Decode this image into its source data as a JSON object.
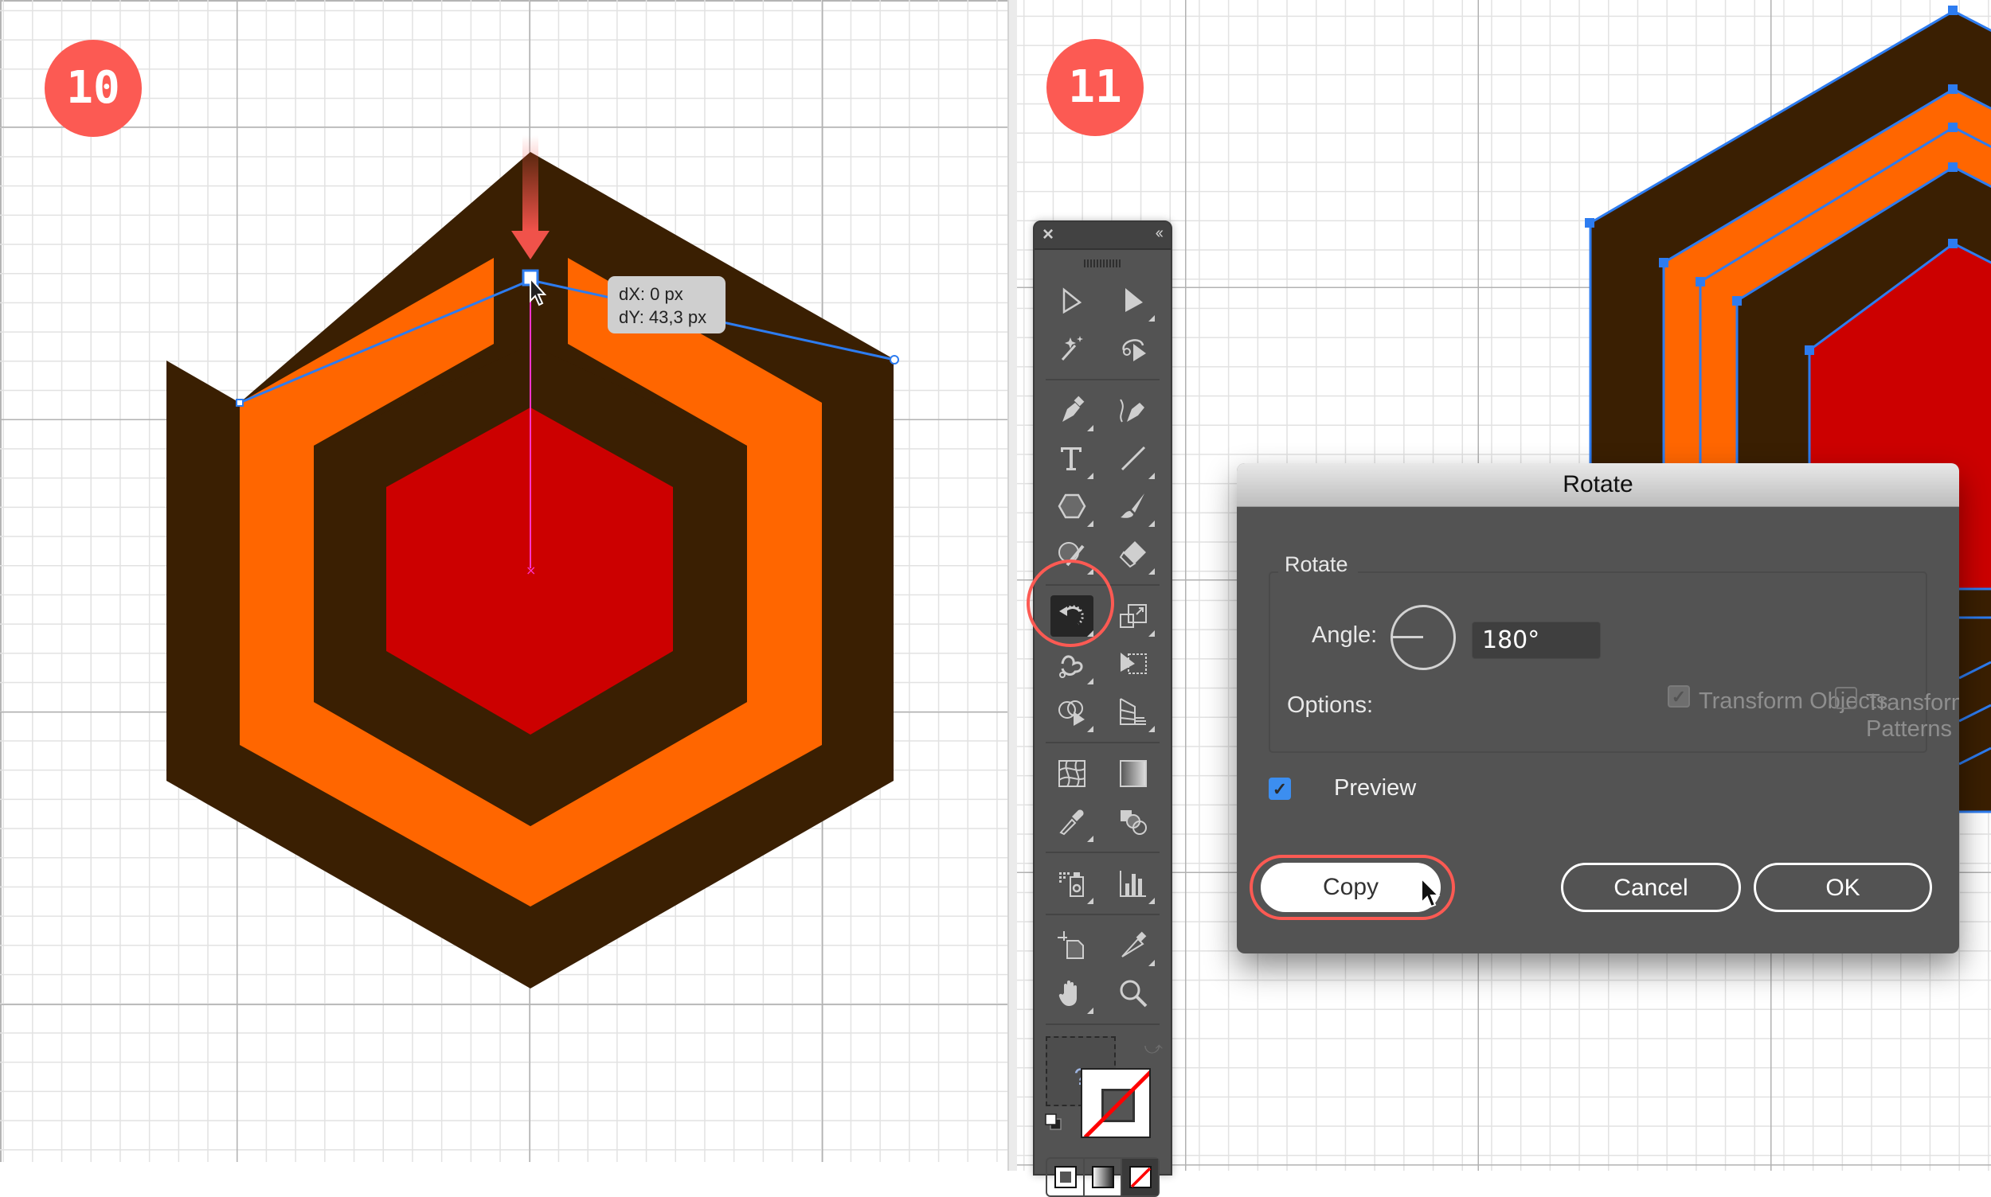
{
  "steps": {
    "left_badge": "10",
    "right_badge": "11"
  },
  "canvas_left": {
    "tooltip": {
      "dx": "dX: 0 px",
      "dy": "dY: 43,3 px"
    },
    "colors": {
      "dark_brown": "#3a1f02",
      "orange": "#ff6600",
      "red": "#cc0000",
      "selection_blue": "#2d7cf0",
      "guide_magenta": "#ff33cc",
      "arrow_red": "#f0524a"
    }
  },
  "toolbar": {
    "close_icon": "×",
    "collapse_icon": "‹‹",
    "tools": [
      [
        "selection-tool",
        "direct-selection-tool"
      ],
      [
        "magic-wand-tool",
        "lasso-tool"
      ],
      [
        "pen-tool",
        "curvature-tool"
      ],
      [
        "type-tool",
        "line-segment-tool"
      ],
      [
        "polygon-tool",
        "paintbrush-tool"
      ],
      [
        "shaper-tool",
        "eraser-tool"
      ],
      [
        "rotate-tool",
        "scale-tool"
      ],
      [
        "puppet-warp-tool",
        "free-transform-tool"
      ],
      [
        "shape-builder-tool",
        "perspective-grid-tool"
      ],
      [
        "mesh-tool",
        "gradient-tool"
      ],
      [
        "eyedropper-tool",
        "blend-tool"
      ],
      [
        "symbol-sprayer-tool",
        "column-graph-tool"
      ],
      [
        "artboard-tool",
        "slice-tool"
      ],
      [
        "hand-tool",
        "zoom-tool"
      ]
    ],
    "active_tool": "rotate-tool",
    "fill_label": "?"
  },
  "dialog": {
    "title": "Rotate",
    "group_label": "Rotate",
    "angle_label": "Angle:",
    "angle_value": "180°",
    "options_label": "Options:",
    "transform_objects": {
      "label": "Transform Objects",
      "checked": true,
      "disabled": true
    },
    "transform_patterns": {
      "label": "Transform Patterns",
      "checked": false,
      "disabled": true
    },
    "preview": {
      "label": "Preview",
      "checked": true
    },
    "buttons": {
      "copy": "Copy",
      "cancel": "Cancel",
      "ok": "OK"
    }
  }
}
